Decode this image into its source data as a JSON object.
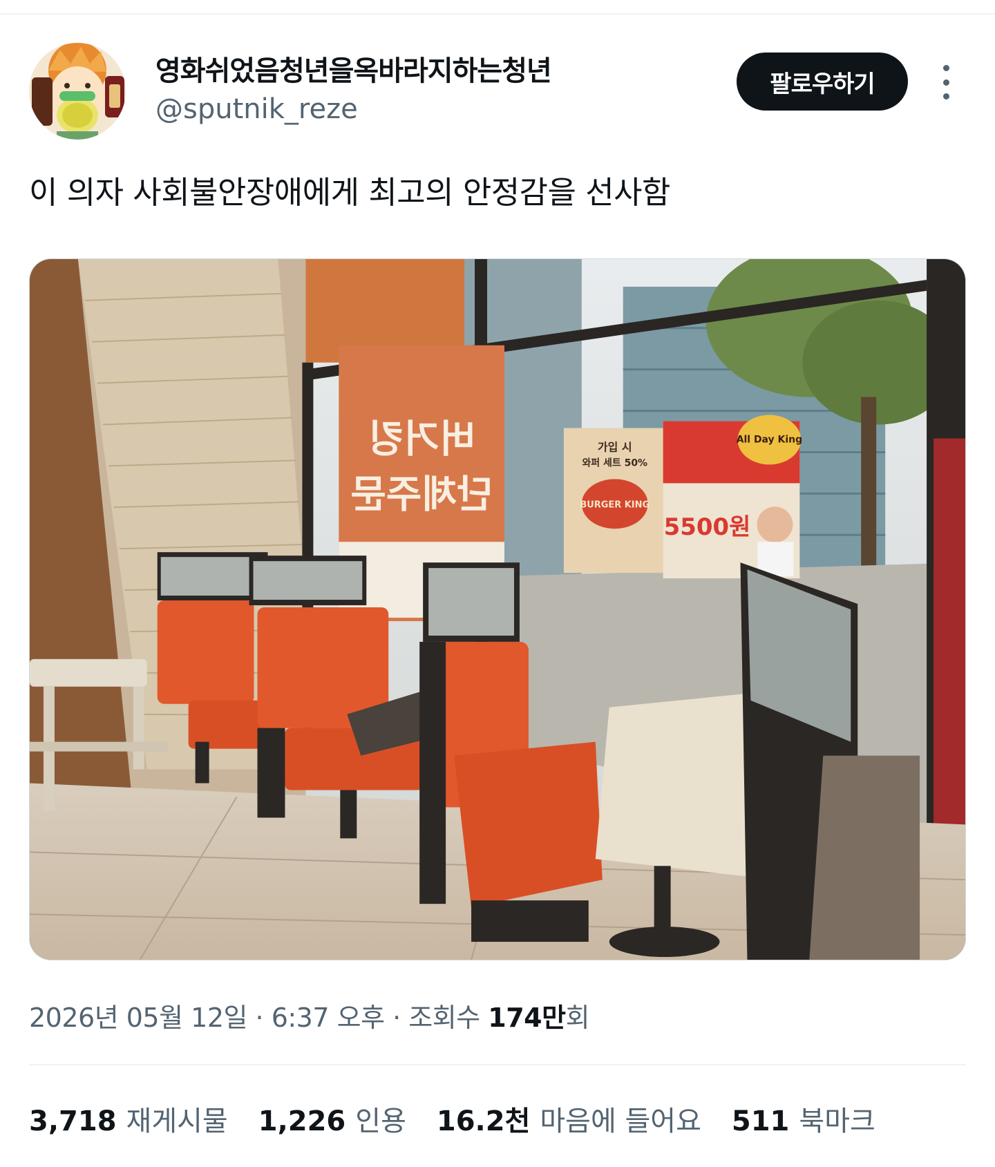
{
  "author": {
    "display_name": "영화쉬었음청년을옥바라지하는청년",
    "handle": "@sputnik_reze",
    "avatar_icon": "anime-avatar"
  },
  "follow_button_label": "팔로우하기",
  "more_icon": "more-vertical-icon",
  "tweet": {
    "text": "이 의자 사회불안장애에게 최고의 안정감을 선사함"
  },
  "media": {
    "description_icon": "photo-restaurant-booth",
    "poster_left": {
      "line1": "버거킹",
      "line2": "단체주문"
    },
    "poster_center": {
      "line1": "가입 시",
      "line2": "와퍼 세트 50%",
      "brand": "BURGER KING"
    },
    "poster_right": {
      "badge": "All Day King",
      "price": "5500원"
    }
  },
  "meta": {
    "date": "2026년 05월 12일",
    "separator": " · ",
    "time": "6:37 오후",
    "views_label": "조회수 ",
    "views_num": "174만",
    "views_suffix": "회"
  },
  "stats": {
    "reposts_num": "3,718",
    "reposts_label": "재게시물",
    "quotes_num": "1,226",
    "quotes_label": "인용",
    "likes_num": "16.2천",
    "likes_label": "마음에 들어요",
    "bookmarks_num": "511",
    "bookmarks_label": "북마크"
  },
  "colors": {
    "text_primary": "#0f1419",
    "text_secondary": "#536471",
    "button_bg": "#0f1419",
    "seat_orange": "#e0582c"
  }
}
